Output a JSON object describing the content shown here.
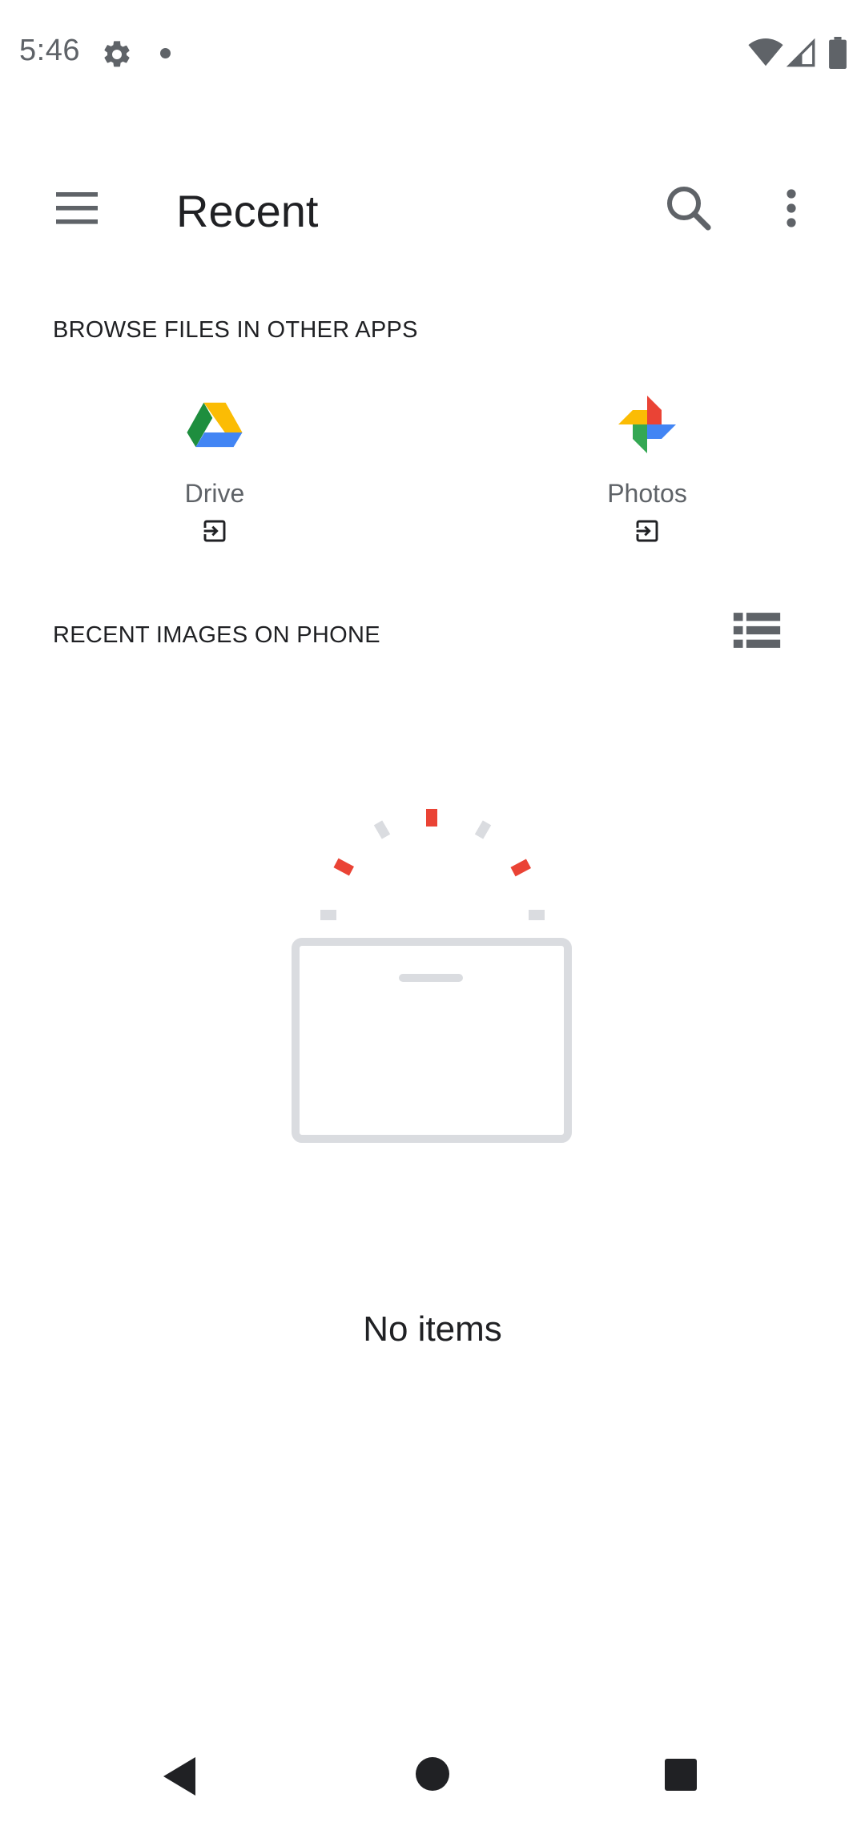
{
  "status_bar": {
    "time": "5:46",
    "icons": [
      "gear-icon",
      "notification-dot-icon",
      "wifi-icon",
      "signal-icon",
      "battery-icon"
    ]
  },
  "toolbar": {
    "title": "Recent",
    "icons": [
      "menu-icon",
      "search-icon",
      "more-vert-icon"
    ]
  },
  "browse_section": {
    "header": "BROWSE FILES IN OTHER APPS",
    "apps": [
      {
        "label": "Drive",
        "icon": "google-drive-icon"
      },
      {
        "label": "Photos",
        "icon": "google-photos-icon"
      }
    ]
  },
  "recent_section": {
    "header": "RECENT IMAGES ON PHONE",
    "view_icon": "list-view-icon"
  },
  "empty_state": {
    "text": "No items"
  },
  "nav_bar": {
    "icons": [
      "back-icon",
      "home-icon",
      "recents-icon"
    ]
  },
  "colors": {
    "text_primary": "#202124",
    "text_secondary": "#5f6368",
    "illustration_gray": "#dadce0",
    "illustration_red": "#ea4335"
  }
}
